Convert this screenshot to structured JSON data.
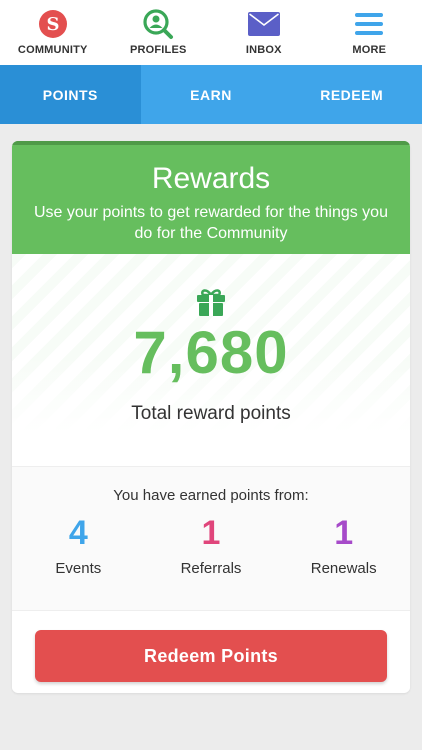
{
  "topnav": {
    "items": [
      {
        "label": "COMMUNITY",
        "icon": "community-logo-icon",
        "color": "#e34f4f"
      },
      {
        "label": "PROFILES",
        "icon": "profile-search-icon",
        "color": "#3aa757"
      },
      {
        "label": "INBOX",
        "icon": "envelope-icon",
        "color": "#5b5fc7"
      },
      {
        "label": "MORE",
        "icon": "hamburger-menu-icon",
        "color": "#3fa5ea"
      }
    ]
  },
  "tabs": {
    "items": [
      {
        "label": "POINTS",
        "active": true
      },
      {
        "label": "EARN",
        "active": false
      },
      {
        "label": "REDEEM",
        "active": false
      }
    ]
  },
  "rewards": {
    "title": "Rewards",
    "subtitle": "Use your points to get rewarded for the things you do for the Community",
    "icon": "gift-icon",
    "points": "7,680",
    "points_label": "Total reward points"
  },
  "earned": {
    "title": "You have earned points from:",
    "stats": [
      {
        "value": "4",
        "label": "Events",
        "color": "#3fa5ea"
      },
      {
        "value": "1",
        "label": "Referrals",
        "color": "#e0457b"
      },
      {
        "value": "1",
        "label": "Renewals",
        "color": "#a64ac9"
      }
    ]
  },
  "redeem_button": {
    "label": "Redeem Points"
  },
  "colors": {
    "accent_green": "#66be5e",
    "tab_blue": "#3fa5ea",
    "button_red": "#e34f4f"
  }
}
